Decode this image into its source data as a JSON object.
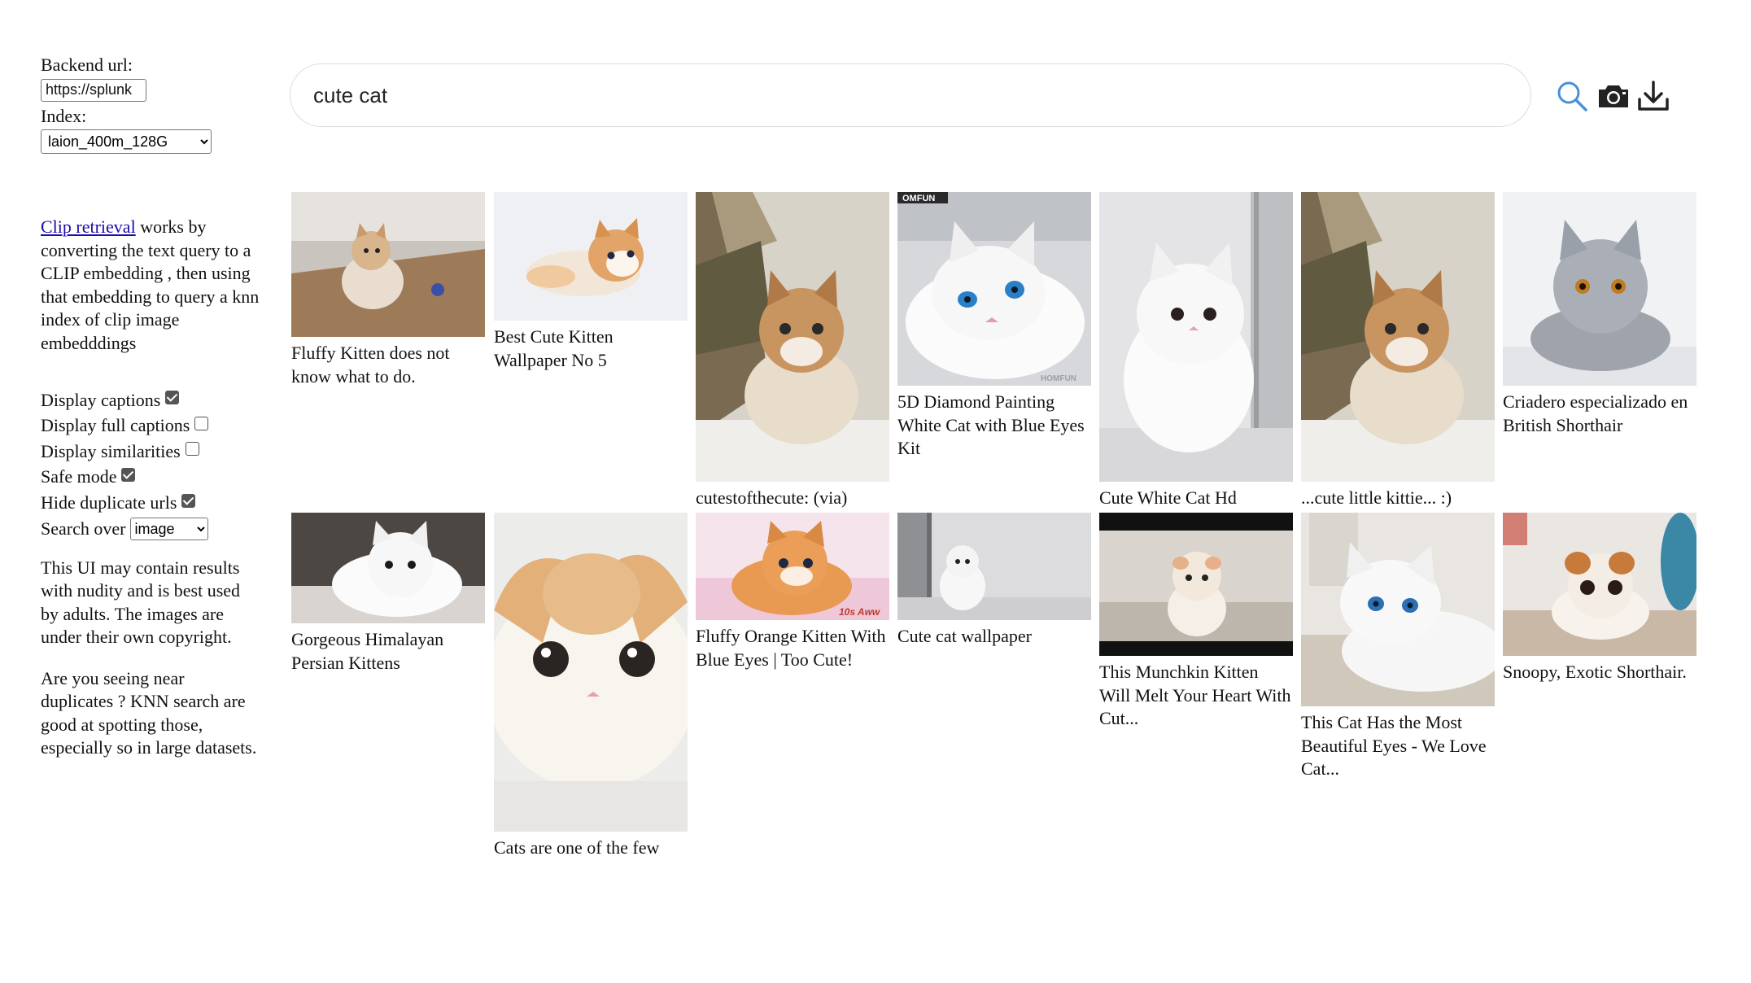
{
  "sidebar": {
    "backend_label": "Backend url:",
    "backend_value": "https://splunk",
    "index_label": "Index:",
    "index_value": "laion_400m_128G",
    "description_link": "Clip retrieval",
    "description_text": " works by converting the text query to a CLIP embedding , then using that embedding to query a knn index of clip image embedddings",
    "options": [
      {
        "label": "Display captions",
        "checked": true
      },
      {
        "label": "Display full captions",
        "checked": false
      },
      {
        "label": "Display similarities",
        "checked": false
      },
      {
        "label": "Safe mode",
        "checked": true
      },
      {
        "label": "Hide duplicate urls",
        "checked": true
      }
    ],
    "search_over_label": "Search over",
    "search_over_value": "image",
    "note_nudity": "This UI may contain results with nudity and is best used by adults. The images are under their own copyright.",
    "note_duplicates": "Are you seeing near duplicates ? KNN search are good at spotting those, especially so in large datasets."
  },
  "search": {
    "query": "cute cat"
  },
  "toolbar": {
    "search_icon": "search-icon",
    "camera_icon": "camera-icon",
    "download_icon": "download-icon",
    "accent": "#4a90d9"
  },
  "results": [
    {
      "caption": "Fluffy Kitten does not know what to do."
    },
    {
      "caption": "Best Cute Kitten Wallpaper No 5"
    },
    {
      "caption": "cutestofthecute: (via)"
    },
    {
      "caption": "5D Diamond Painting White Cat with Blue Eyes Kit",
      "watermark": "OMFUN",
      "watermark2": "HOMFUN"
    },
    {
      "caption": "Cute White Cat Hd"
    },
    {
      "caption": "...cute little kittie... :)"
    },
    {
      "caption": "Criadero especializado en British Shorthair"
    },
    {
      "caption": "Gorgeous Himalayan Persian Kittens"
    },
    {
      "caption": "Cats are one of the few"
    },
    {
      "caption": "Fluffy Orange Kitten With Blue Eyes | Too Cute!",
      "watermark": "10s Aww"
    },
    {
      "caption": "Cute cat wallpaper"
    },
    {
      "caption": "This Munchkin Kitten Will Melt Your Heart With Cut..."
    },
    {
      "caption": "This Cat Has the Most Beautiful Eyes - We Love Cat..."
    },
    {
      "caption": "Snoopy, Exotic Shorthair."
    }
  ]
}
